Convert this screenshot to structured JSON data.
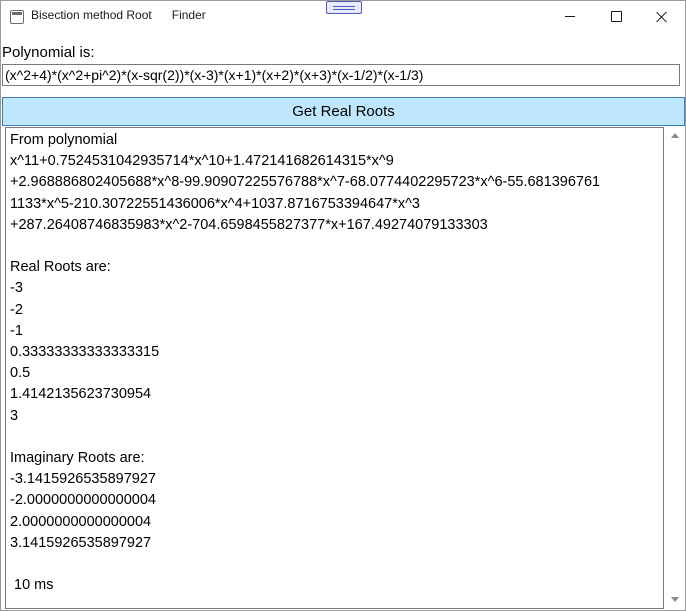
{
  "window": {
    "title": "Bisection method Root      Finder"
  },
  "form": {
    "polynomial_label": "Polynomial is:",
    "polynomial_value": "(x^2+4)*(x^2+pi^2)*(x-sqr(2))*(x-3)*(x+1)*(x+2)*(x+3)*(x-1/2)*(x-1/3)",
    "get_roots_label": "Get Real Roots"
  },
  "output": {
    "text": "From polynomial\nx^11+0.7524531042935714*x^10+1.472141682614315*x^9\n+2.968886802405688*x^8-99.90907225576788*x^7-68.0774402295723*x^6-55.681396761\n1133*x^5-210.30722551436006*x^4+1037.8716753394647*x^3\n+287.26408746835983*x^2-704.6598455827377*x+167.49274079133303\n\nReal Roots are:\n-3\n-2\n-1\n0.33333333333333315\n0.5\n1.4142135623730954\n3\n\nImaginary Roots are:\n-3.1415926535897927\n-2.0000000000000004\n2.0000000000000004\n3.1415926535897927\n\n 10 ms"
  },
  "icons": {
    "app": "app-window-icon",
    "minimize": "minimize-icon",
    "maximize": "maximize-icon",
    "close": "close-icon"
  },
  "colors": {
    "button_bg": "#bee6fd",
    "button_border": "#3c7fb1"
  }
}
